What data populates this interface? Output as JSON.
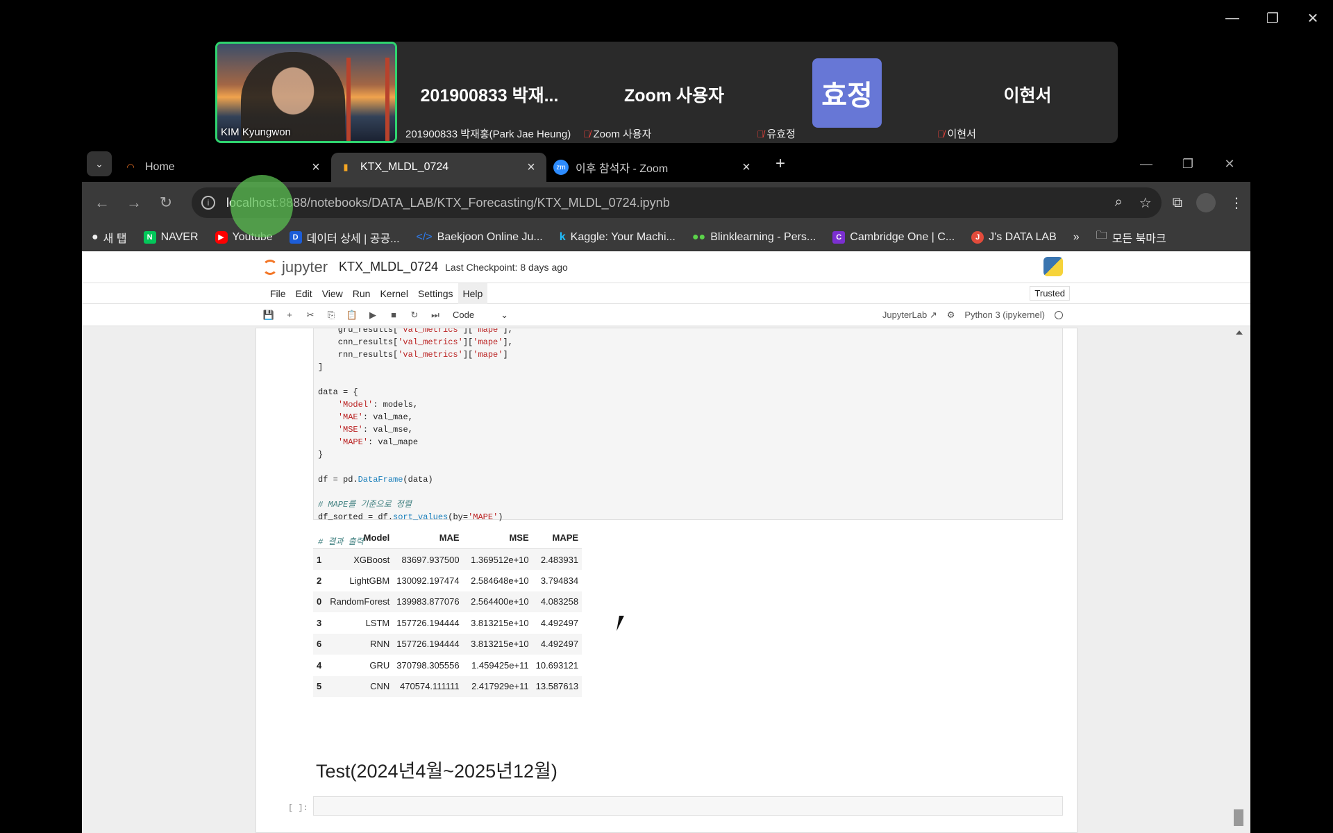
{
  "zoom": {
    "participants": [
      {
        "big": "",
        "name": "KIM Kyungwon",
        "video": true
      },
      {
        "big": "201900833 박재...",
        "name": "201900833 박재홍(Park Jae Heung)"
      },
      {
        "big": "Zoom 사용자",
        "name": "Zoom 사용자"
      },
      {
        "big": "효정",
        "name": "유효정"
      },
      {
        "big": "이현서",
        "name": "이현서"
      }
    ]
  },
  "browser": {
    "tabs": [
      {
        "title": "Home",
        "icon": "jupyter-icon"
      },
      {
        "title": "KTX_MLDL_0724",
        "icon": "notebook-icon"
      },
      {
        "title": "이후 참석자 - Zoom",
        "icon": "zoom-icon"
      }
    ],
    "url_host": "localhost",
    "url_path": ":8888/notebooks/DATA_LAB/KTX_Forecasting/KTX_MLDL_0724.ipynb",
    "bookmarks": [
      "새 탭",
      "NAVER",
      "Youtube",
      "데이터 상세 | 공공...",
      "Baekjoon Online Ju...",
      "Kaggle: Your Machi...",
      "Blinklearning - Pers...",
      "Cambridge One | C...",
      "J's DATA LAB"
    ],
    "all_bookmarks": "모든 북마크"
  },
  "jupyter": {
    "logo": "jupyter",
    "notebook": "KTX_MLDL_0724",
    "checkpoint": "Last Checkpoint: 8 days ago",
    "menu": [
      "File",
      "Edit",
      "View",
      "Run",
      "Kernel",
      "Settings",
      "Help"
    ],
    "trusted": "Trusted",
    "cell_type": "Code",
    "jupyterlab": "JupyterLab",
    "kernel": "Python 3 (ipykernel)",
    "table": {
      "columns": [
        "",
        "Model",
        "MAE",
        "MSE",
        "MAPE"
      ],
      "rows": [
        [
          "1",
          "XGBoost",
          "83697.937500",
          "1.369512e+10",
          "2.483931"
        ],
        [
          "2",
          "LightGBM",
          "130092.197474",
          "2.584648e+10",
          "3.794834"
        ],
        [
          "0",
          "RandomForest",
          "139983.877076",
          "2.564400e+10",
          "4.083258"
        ],
        [
          "3",
          "LSTM",
          "157726.194444",
          "3.813215e+10",
          "4.492497"
        ],
        [
          "6",
          "RNN",
          "157726.194444",
          "3.813215e+10",
          "4.492497"
        ],
        [
          "4",
          "GRU",
          "370798.305556",
          "1.459425e+11",
          "10.693121"
        ],
        [
          "5",
          "CNN",
          "470574.111111",
          "2.417929e+11",
          "13.587613"
        ]
      ]
    },
    "heading": "Test(2024년4월~2025년12월)",
    "prompt": "[ ]:"
  }
}
